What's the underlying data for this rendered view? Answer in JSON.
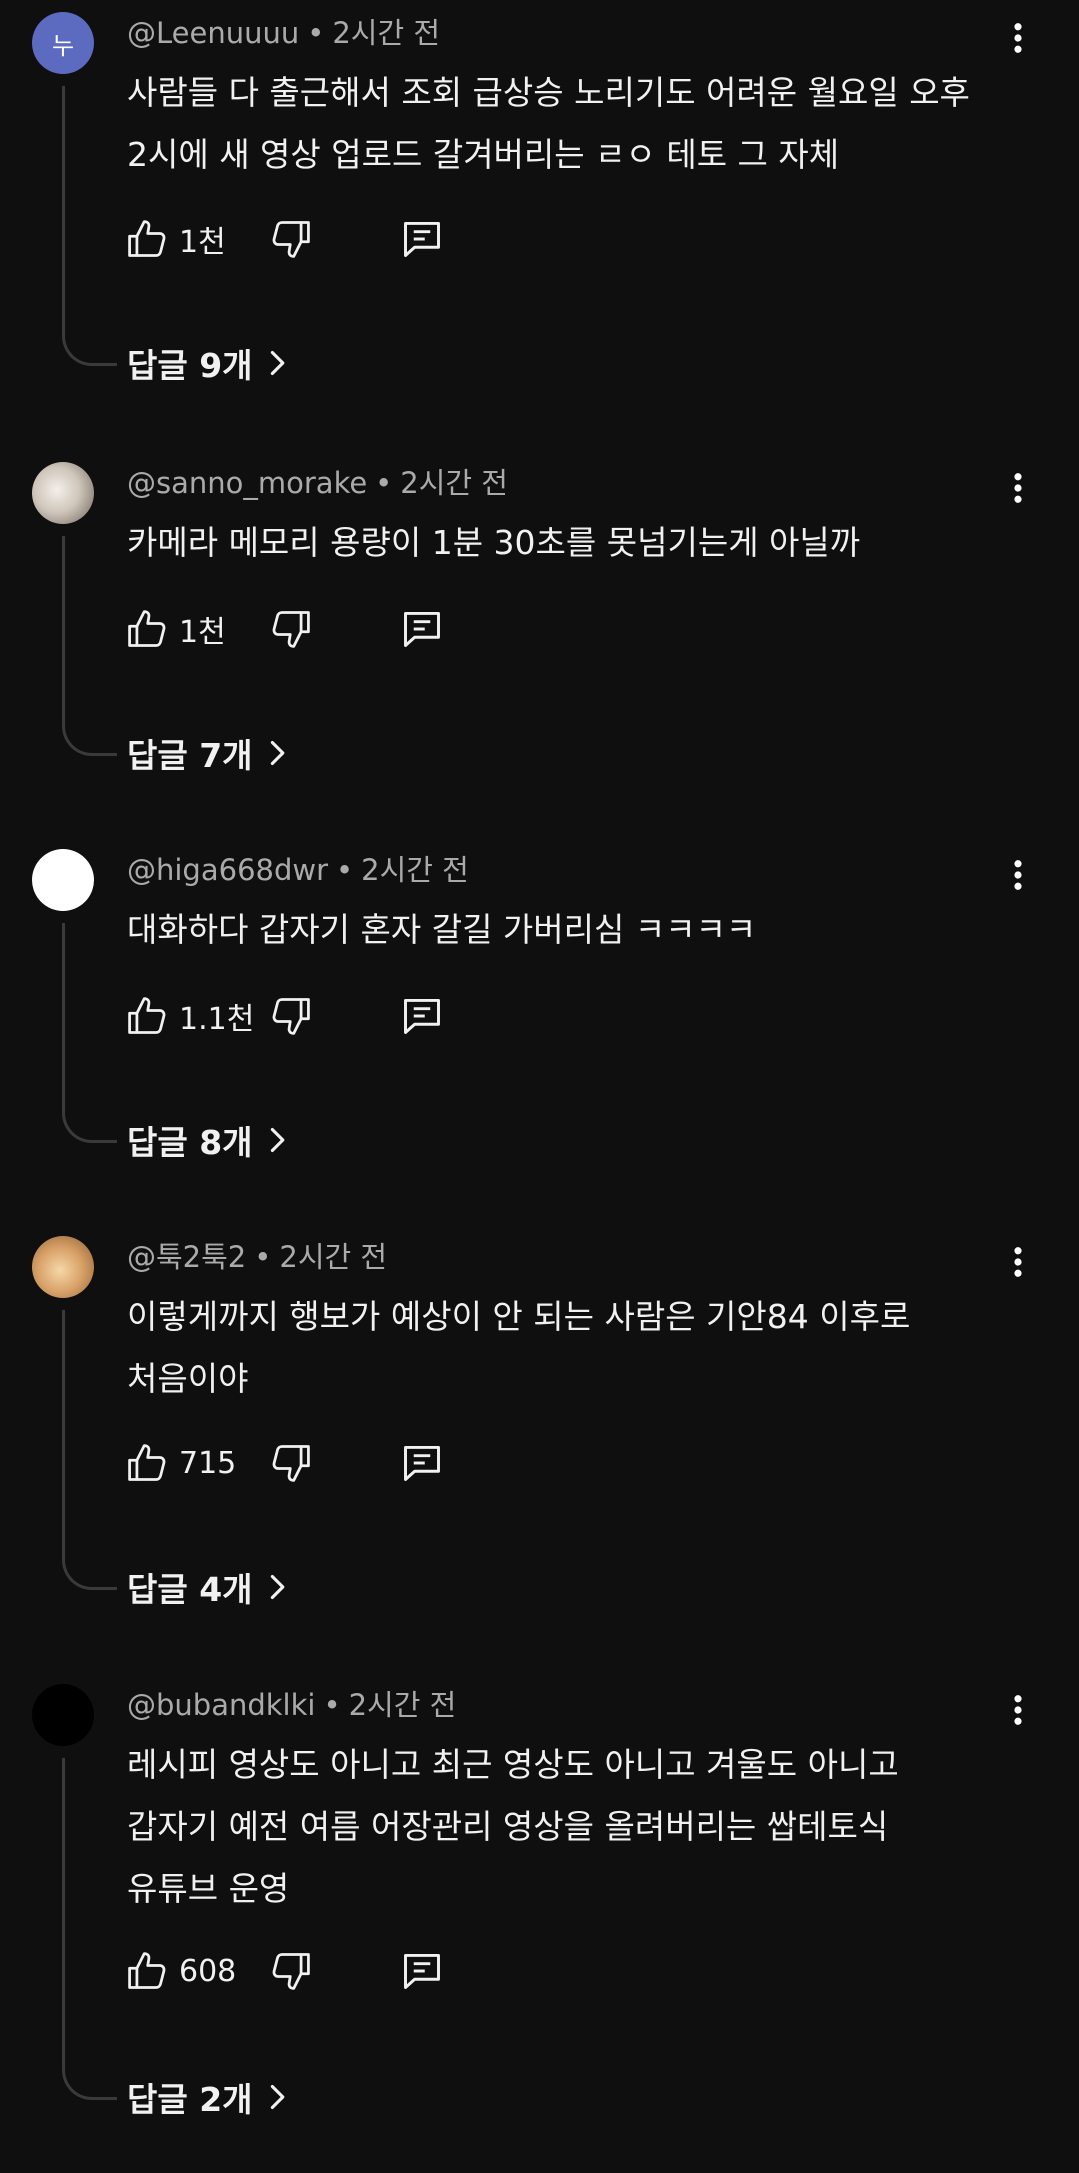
{
  "comments": [
    {
      "author": "@Leenuuuu",
      "time": "2시간 전",
      "avatar_text": "누",
      "avatar_color": "#5c6bc0",
      "lines": [
        "사람들 다 출근해서 조회 급상승 노리기도 어려운 월요일 오후",
        "2시에 새 영상 업로드 갈겨버리는 ㄹㅇ 테토 그 자체"
      ],
      "likes": "1천",
      "replies": "답글 9개"
    },
    {
      "author": "@sanno_morake",
      "time": "2시간 전",
      "avatar_text": "",
      "avatar_color": "#d9d2c8",
      "lines": [
        "카메라 메모리 용량이 1분 30초를 못넘기는게 아닐까"
      ],
      "likes": "1천",
      "replies": "답글 7개"
    },
    {
      "author": "@higa668dwr",
      "time": "2시간 전",
      "avatar_text": "",
      "avatar_color": "#ffffff",
      "lines": [
        "대화하다 갑자기 혼자 갈길 가버리심 ㅋㅋㅋㅋ"
      ],
      "likes": "1.1천",
      "replies": "답글 8개"
    },
    {
      "author": "@툭2툭2",
      "time": "2시간 전",
      "avatar_text": "",
      "avatar_color": "#d9a36a",
      "lines": [
        "이렇게까지 행보가 예상이 안 되는 사람은 기안84 이후로",
        "처음이야"
      ],
      "likes": "715",
      "replies": "답글 4개"
    },
    {
      "author": "@bubandklki",
      "time": "2시간 전",
      "avatar_text": "",
      "avatar_color": "#000000",
      "lines": [
        "레시피 영상도 아니고 최근 영상도 아니고 겨울도 아니고",
        "갑자기 예전 여름 어장관리 영상을 올려버리는 쌉테토식",
        "유튜브 운영"
      ],
      "likes": "608",
      "replies": "답글 2개"
    }
  ]
}
